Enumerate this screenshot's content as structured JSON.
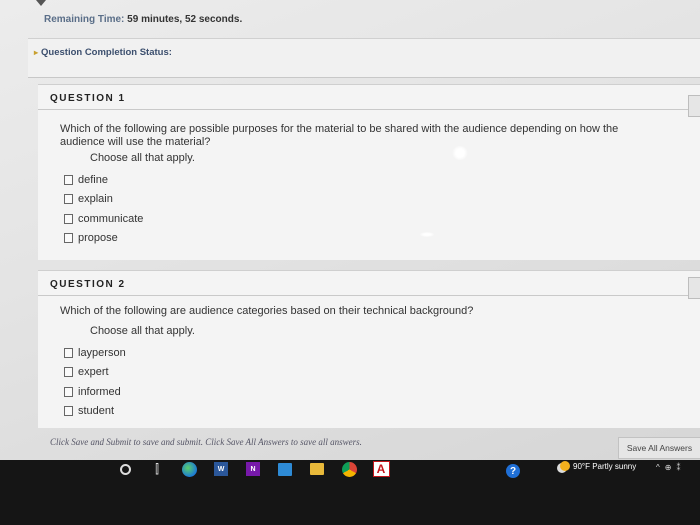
{
  "timer": {
    "label": "Remaining Time:",
    "value": "59 minutes, 52 seconds."
  },
  "status": {
    "toggle_label": "Question Completion Status:"
  },
  "questions": [
    {
      "heading": "QUESTION 1",
      "text": "Which of the following are possible purposes for the material to be shared with the audience depending on how the audience will use the material?",
      "instruction": "Choose all that apply.",
      "options": [
        "define",
        "explain",
        "communicate",
        "propose"
      ]
    },
    {
      "heading": "QUESTION 2",
      "text": "Which of the following are audience categories based on their technical background?",
      "instruction": "Choose all that apply.",
      "options": [
        "layperson",
        "expert",
        "informed",
        "student"
      ]
    }
  ],
  "footer": {
    "message": "Click Save and Submit to save and submit. Click Save All Answers to save all answers.",
    "save_all_label": "Save All Answers"
  },
  "taskbar": {
    "icons": [
      "search-icon",
      "task-view-icon",
      "edge-icon",
      "word-icon",
      "onenote-icon",
      "store-icon",
      "file-explorer-icon",
      "chrome-icon",
      "acrobat-icon",
      "help-icon"
    ],
    "word_letter": "W",
    "onenote_letter": "N",
    "acrobat_letter": "A",
    "help_glyph": "?",
    "weather": "90°F Partly sunny"
  },
  "colors": {
    "taskbar": "#151515",
    "label_blue": "#3c4f6e",
    "page_bg": "#e4e4e4"
  }
}
